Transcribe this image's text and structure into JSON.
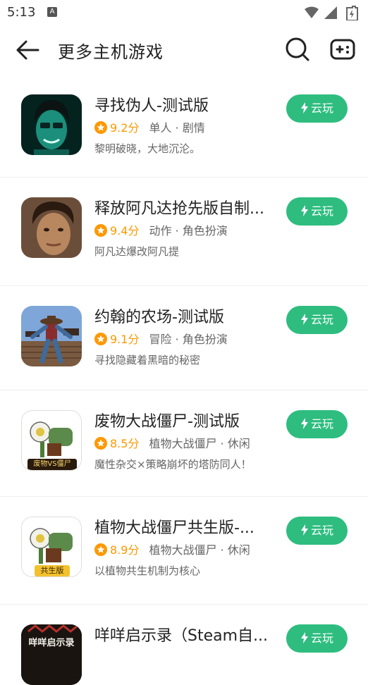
{
  "status": {
    "time": "5:13",
    "notif_letter": "A"
  },
  "header": {
    "title": "更多主机游戏"
  },
  "colors": {
    "accent": "#2ebd7f",
    "star": "#ff9800"
  },
  "games": [
    {
      "title": "寻找伪人-测试版",
      "score": "9.2分",
      "tags": "单人 · 剧情",
      "desc": "黎明破晓，大地沉沦。",
      "button": "云玩"
    },
    {
      "title": "释放阿凡达抢先版自制...",
      "score": "9.4分",
      "tags": "动作 · 角色扮演",
      "desc": "阿凡达爆改阿凡提",
      "button": "云玩"
    },
    {
      "title": "约翰的农场-测试版",
      "score": "9.1分",
      "tags": "冒险 · 角色扮演",
      "desc": "寻找隐藏着黑暗的秘密",
      "button": "云玩"
    },
    {
      "title": "废物大战僵尸-测试版",
      "score": "8.5分",
      "tags": "植物大战僵尸 · 休闲",
      "desc": "魔性杂交×策略崩坏的塔防同人！",
      "button": "云玩",
      "logo_text": "废物VS僵尸"
    },
    {
      "title": "植物大战僵尸共生版-...",
      "score": "8.9分",
      "tags": "植物大战僵尸 · 休闲",
      "desc": "以植物共生机制为核心",
      "button": "云玩",
      "logo_text": "共生版"
    },
    {
      "title": "咩咩启示录（Steam自...",
      "score": "",
      "tags": "",
      "desc": "",
      "button": "云玩",
      "logo_text": "咩咩启示录"
    }
  ]
}
